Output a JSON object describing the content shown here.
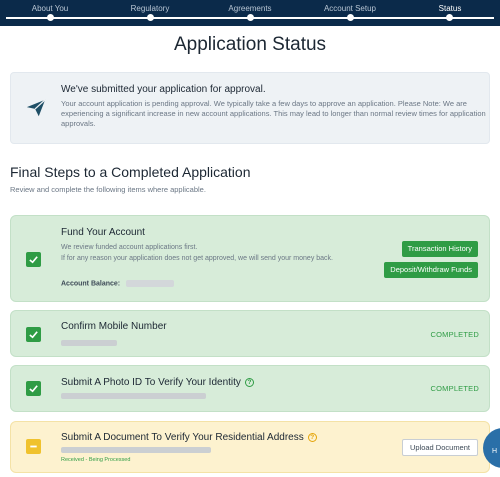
{
  "nav": {
    "steps": [
      "About You",
      "Regulatory",
      "Agreements",
      "Account Setup",
      "Status"
    ],
    "active": "Status"
  },
  "page_title": "Application Status",
  "notice": {
    "title": "We've submitted your application for approval.",
    "body": "Your account application is pending approval. We typically take a few days to approve an application. Please Note: We are experiencing a significant increase in new account applications. This may lead to longer than normal review times for application approvals.",
    "icon": "paper-plane-icon"
  },
  "section": {
    "title": "Final Steps to a Completed Application",
    "subtitle": "Review and complete the following items where applicable."
  },
  "cards": {
    "fund": {
      "title": "Fund Your Account",
      "desc1": "We review funded account applications first.",
      "desc2": "If for any reason your application does not get approved, we will send your money back.",
      "balance_label": "Account Balance:",
      "btn_history": "Transaction History",
      "btn_deposit": "Deposit/Withdraw Funds"
    },
    "mobile": {
      "title": "Confirm Mobile Number",
      "status": "COMPLETED"
    },
    "photo": {
      "title": "Submit A Photo ID To Verify Your Identity",
      "status": "COMPLETED"
    },
    "address": {
      "title": "Submit A Document To Verify Your Residential Address",
      "btn_upload": "Upload Document",
      "status_small": "Received - Being Processed"
    }
  },
  "help": {
    "label": "H"
  },
  "colors": {
    "navy": "#0b2a4a",
    "green": "#2f9c45",
    "green_bg": "#d7ecd9",
    "yellow_bg": "#fdf2cf",
    "yellow": "#f0c22d"
  }
}
